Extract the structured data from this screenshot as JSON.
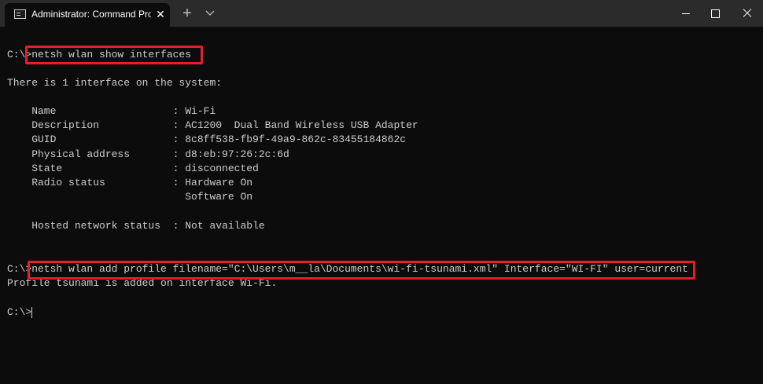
{
  "titlebar": {
    "tab_title": "Administrator: Command Prompt",
    "close_glyph": "✕",
    "new_tab_glyph": "+"
  },
  "terminal": {
    "lines": [
      "C:\\>netsh wlan show interfaces",
      "There is 1 interface on the system:",
      "    Name                   : Wi-Fi",
      "    Description            : AC1200  Dual Band Wireless USB Adapter",
      "    GUID                   : 8c8ff538-fb9f-49a9-862c-83455184862c",
      "    Physical address       : d8:eb:97:26:2c:6d",
      "    State                  : disconnected",
      "    Radio status           : Hardware On",
      "                             Software On",
      "    Hosted network status  : Not available",
      "C:\\>netsh wlan add profile filename=\"C:\\Users\\m__la\\Documents\\wi-fi-tsunami.xml\" Interface=\"WI-FI\" user=current",
      "Profile tsunami is added on interface Wi-Fi.",
      "C:\\>"
    ]
  },
  "colors": {
    "highlight": "#e41f2b",
    "text": "#cccccc",
    "background": "#0c0c0c",
    "titlebar": "#2b2b2b"
  }
}
